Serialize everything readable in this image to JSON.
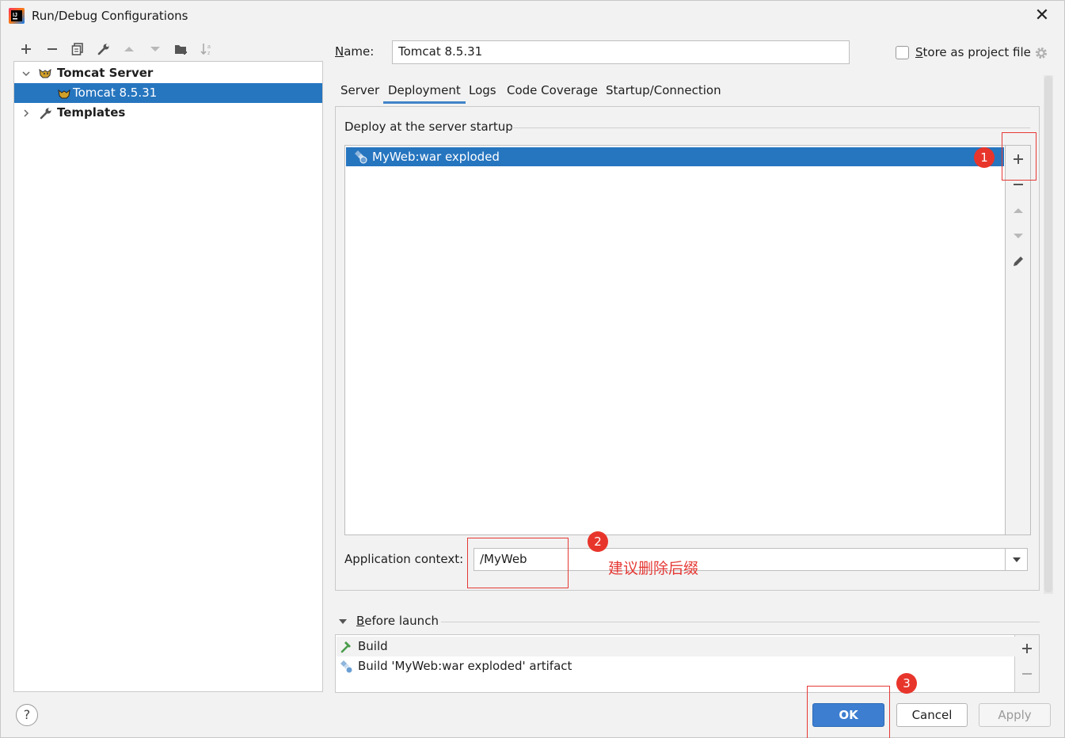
{
  "window": {
    "title": "Run/Debug Configurations",
    "close_glyph": "✕"
  },
  "toolbar": {
    "icons": [
      "plus-icon",
      "minus-icon",
      "copy-icon",
      "wrench-icon",
      "arrow-up-icon",
      "arrow-down-icon",
      "new-folder-icon",
      "sort-icon"
    ]
  },
  "tree": {
    "group_label": "Tomcat Server",
    "selected_item": "Tomcat 8.5.31",
    "templates_label": "Templates"
  },
  "name_field": {
    "label_first": "N",
    "label_rest": "ame:",
    "value": "Tomcat 8.5.31"
  },
  "store_project": {
    "label_first": "S",
    "label_rest": "tore as project file",
    "checked": false
  },
  "tabs": [
    {
      "label": "Server",
      "active": false
    },
    {
      "label": "Deployment",
      "active": true
    },
    {
      "label": "Logs",
      "active": false
    },
    {
      "label": "Code Coverage",
      "active": false
    },
    {
      "label": "Startup/Connection",
      "active": false
    }
  ],
  "deployment": {
    "section_title": "Deploy at the server startup",
    "artifact": "MyWeb:war exploded",
    "context_label": "Application context:",
    "context_value": "/MyWeb"
  },
  "annotations": {
    "badge1": "1",
    "badge2": "2",
    "badge3": "3",
    "note": "建议删除后缀",
    "color": "#e53935"
  },
  "before_launch": {
    "title_first": "B",
    "title_rest": "efore launch",
    "items": [
      "Build",
      "Build 'MyWeb:war exploded' artifact"
    ]
  },
  "buttons": {
    "ok": "OK",
    "cancel": "Cancel",
    "apply": "Apply",
    "help": "?"
  },
  "colors": {
    "selection": "#2675bf",
    "primary_button": "#3d7ed0",
    "tab_underline": "#4083c9"
  }
}
